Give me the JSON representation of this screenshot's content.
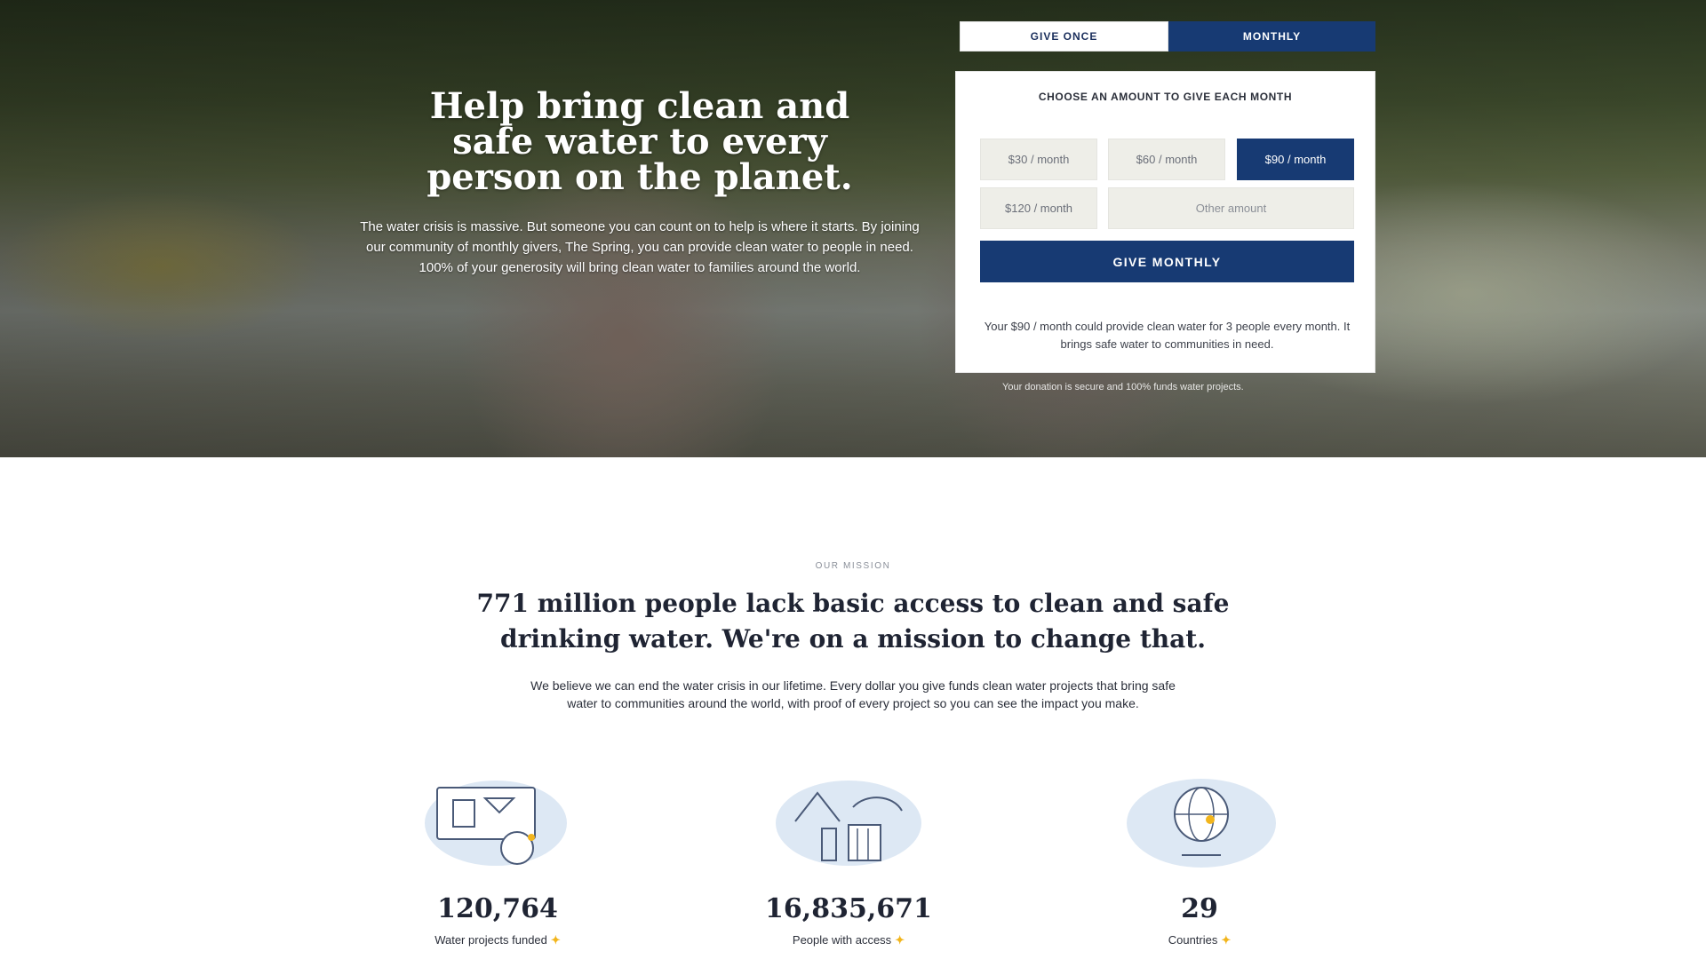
{
  "hero": {
    "title": "Help bring clean and safe water to every person on the planet.",
    "description": "The water crisis is massive. But someone you can count on to help is where it starts. By joining our community of monthly givers, The Spring, you can provide clean water to people in need. 100% of your generosity will bring clean water to families around the world."
  },
  "donation": {
    "tabs": [
      {
        "label": "GIVE ONCE",
        "active": false
      },
      {
        "label": "MONTHLY",
        "active": true
      }
    ],
    "prompt": "CHOOSE AN AMOUNT TO GIVE EACH MONTH",
    "amounts": [
      {
        "label": "$30 / month",
        "selected": false
      },
      {
        "label": "$60 / month",
        "selected": false
      },
      {
        "label": "$90 / month",
        "selected": true
      },
      {
        "label": "$120 / month",
        "selected": false
      }
    ],
    "custom_placeholder": "Other amount",
    "donate_label": "GIVE MONTHLY",
    "note": "Your $90 / month could provide clean water for 3 people every month. It brings safe water to communities in need.",
    "secure_note": "Your donation is secure and 100% funds water projects."
  },
  "mission": {
    "eyebrow": "OUR MISSION",
    "title": "771 million people lack basic access to clean and safe drinking water. We're on a mission to change that.",
    "description": "We believe we can end the water crisis in our lifetime. Every dollar you give funds clean water projects that bring safe water to communities around the world, with proof of every project so you can see the impact you make."
  },
  "stats": [
    {
      "value": "120,764",
      "label": "Water projects funded",
      "icon": "water-project-icon"
    },
    {
      "value": "16,835,671",
      "label": "People with access",
      "icon": "people-served-icon"
    },
    {
      "value": "29",
      "label": "Countries",
      "icon": "globe-icon"
    }
  ],
  "colors": {
    "navy": "#173a73",
    "accent_yellow": "#f2b51c",
    "input_bg": "#eeeee8"
  }
}
